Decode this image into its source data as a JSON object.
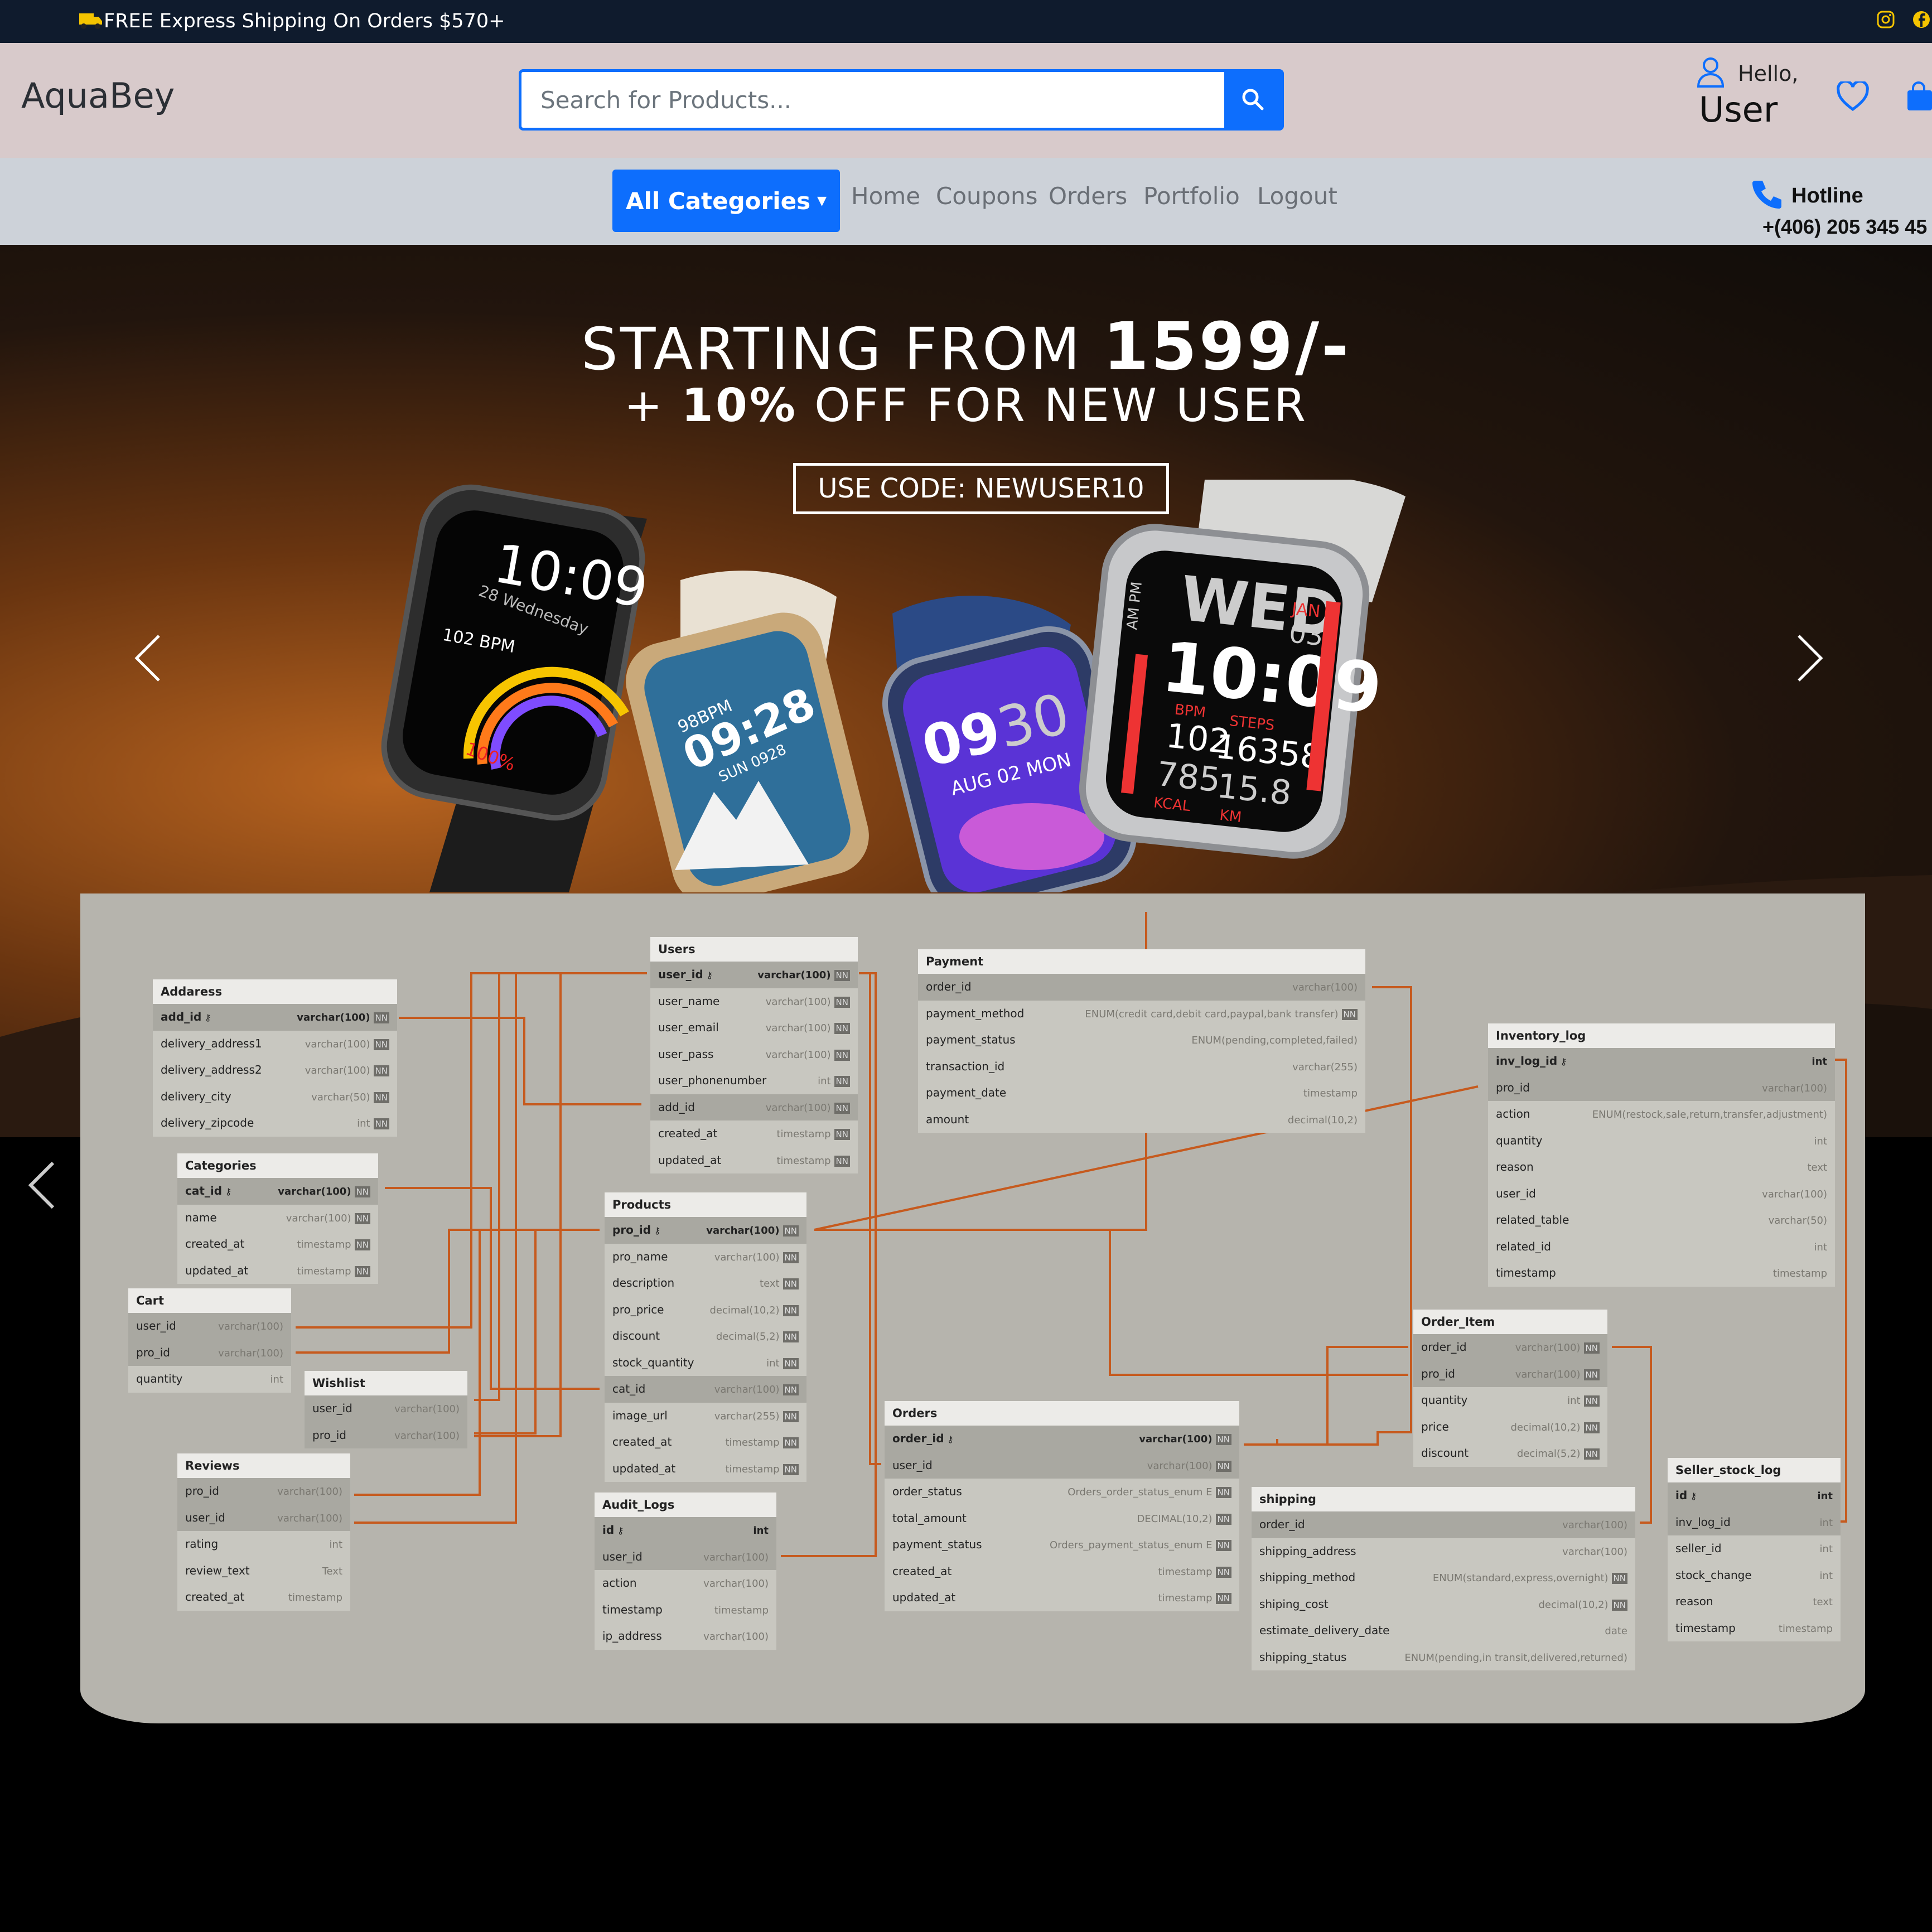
{
  "topbar": {
    "shipping_text": "FREE Express Shipping On Orders $570+",
    "icons": [
      "truck-icon",
      "instagram-icon",
      "facebook-icon"
    ]
  },
  "header": {
    "logo": "AquaBey",
    "search": {
      "placeholder": "Search for Products...",
      "button_icon": "search-icon"
    },
    "greeting": "Hello,",
    "user": "User",
    "icons": [
      "user-icon",
      "heart-icon",
      "cart-icon"
    ]
  },
  "nav": {
    "all_categories": "All Categories",
    "links": [
      "Home",
      "Coupons",
      "Orders",
      "Portfolio",
      "Logout"
    ],
    "hotline_label": "Hotline",
    "hotline_number": "+(406) 205 345 45"
  },
  "hero": {
    "line1_a": "STARTING FROM ",
    "line1_b": "1599/-",
    "line2_a": "+ ",
    "line2_b": "10%",
    "line2_c": " OFF FOR NEW USER",
    "code": "USE CODE: NEWUSER10",
    "watch1": {
      "time": "10:09",
      "date": "28 Wednesday",
      "bpm": "102 BPM",
      "pct": "100%"
    },
    "watch2": {
      "time": "09:28",
      "bpm": "98BPM",
      "date": "SUN 0928"
    },
    "watch3": {
      "time_a": "09",
      "time_b": "30",
      "date": "AUG 02 MON"
    },
    "watch4": {
      "day": "WED",
      "month": "JAN",
      "dnum": "03",
      "time": "10:09",
      "ampm": "AM PM",
      "bpm": "102",
      "bpm_l": "BPM",
      "steps": "16358",
      "steps_l": "STEPS",
      "kcal": "785",
      "kcal_l": "KCAL",
      "km": "15.8",
      "km_l": "KM"
    }
  },
  "erd": {
    "tables": [
      {
        "name": "Addaress",
        "rows": [
          [
            "add_id",
            "varchar(100)",
            "NN",
            1
          ],
          [
            "delivery_address1",
            "varchar(100)",
            "NN",
            0
          ],
          [
            "delivery_address2",
            "varchar(100)",
            "NN",
            0
          ],
          [
            "delivery_city",
            "varchar(50)",
            "NN",
            0
          ],
          [
            "delivery_zipcode",
            "int",
            "NN",
            0
          ]
        ]
      },
      {
        "name": "Categories",
        "rows": [
          [
            "cat_id",
            "varchar(100)",
            "NN",
            1
          ],
          [
            "name",
            "varchar(100)",
            "NN",
            0
          ],
          [
            "created_at",
            "timestamp",
            "NN",
            0
          ],
          [
            "updated_at",
            "timestamp",
            "NN",
            0
          ]
        ]
      },
      {
        "name": "Cart",
        "rows": [
          [
            "user_id",
            "varchar(100)",
            "",
            2
          ],
          [
            "pro_id",
            "varchar(100)",
            "",
            2
          ],
          [
            "quantity",
            "int",
            "",
            0
          ]
        ]
      },
      {
        "name": "Wishlist",
        "rows": [
          [
            "user_id",
            "varchar(100)",
            "",
            2
          ],
          [
            "pro_id",
            "varchar(100)",
            "",
            2
          ]
        ]
      },
      {
        "name": "Reviews",
        "rows": [
          [
            "pro_id",
            "varchar(100)",
            "",
            2
          ],
          [
            "user_id",
            "varchar(100)",
            "",
            2
          ],
          [
            "rating",
            "int",
            "",
            0
          ],
          [
            "review_text",
            "Text",
            "",
            0
          ],
          [
            "created_at",
            "timestamp",
            "",
            0
          ]
        ]
      },
      {
        "name": "Users",
        "rows": [
          [
            "user_id",
            "varchar(100)",
            "NN",
            1
          ],
          [
            "user_name",
            "varchar(100)",
            "NN",
            0
          ],
          [
            "user_email",
            "varchar(100)",
            "NN",
            0
          ],
          [
            "user_pass",
            "varchar(100)",
            "NN",
            0
          ],
          [
            "user_phonenumber",
            "int",
            "NN",
            0
          ],
          [
            "add_id",
            "varchar(100)",
            "NN",
            2
          ],
          [
            "created_at",
            "timestamp",
            "NN",
            0
          ],
          [
            "updated_at",
            "timestamp",
            "NN",
            0
          ]
        ]
      },
      {
        "name": "Products",
        "rows": [
          [
            "pro_id",
            "varchar(100)",
            "NN",
            1
          ],
          [
            "pro_name",
            "varchar(100)",
            "NN",
            0
          ],
          [
            "description",
            "text",
            "NN",
            0
          ],
          [
            "pro_price",
            "decimal(10,2)",
            "NN",
            0
          ],
          [
            "discount",
            "decimal(5,2)",
            "NN",
            0
          ],
          [
            "stock_quantity",
            "int",
            "NN",
            0
          ],
          [
            "cat_id",
            "varchar(100)",
            "NN",
            2
          ],
          [
            "image_url",
            "varchar(255)",
            "NN",
            0
          ],
          [
            "created_at",
            "timestamp",
            "NN",
            0
          ],
          [
            "updated_at",
            "timestamp",
            "NN",
            0
          ]
        ]
      },
      {
        "name": "Audit_Logs",
        "rows": [
          [
            "id",
            "int",
            "",
            1
          ],
          [
            "user_id",
            "varchar(100)",
            "",
            2
          ],
          [
            "action",
            "varchar(100)",
            "",
            0
          ],
          [
            "timestamp",
            "timestamp",
            "",
            0
          ],
          [
            "ip_address",
            "varchar(100)",
            "",
            0
          ]
        ]
      },
      {
        "name": "Payment",
        "rows": [
          [
            "order_id",
            "varchar(100)",
            "",
            2
          ],
          [
            "payment_method",
            "ENUM(credit card,debit card,paypal,bank transfer)",
            "NN",
            0
          ],
          [
            "payment_status",
            "ENUM(pending,completed,failed)",
            "",
            0
          ],
          [
            "transaction_id",
            "varchar(255)",
            "",
            0
          ],
          [
            "payment_date",
            "timestamp",
            "",
            0
          ],
          [
            "amount",
            "decimal(10,2)",
            "",
            0
          ]
        ]
      },
      {
        "name": "Orders",
        "rows": [
          [
            "order_id",
            "varchar(100)",
            "NN",
            1
          ],
          [
            "user_id",
            "varchar(100)",
            "NN",
            2
          ],
          [
            "order_status",
            "Orders_order_status_enum  E",
            "NN",
            0
          ],
          [
            "total_amount",
            "DECIMAL(10,2)",
            "NN",
            0
          ],
          [
            "payment_status",
            "Orders_payment_status_enum  E",
            "NN",
            0
          ],
          [
            "created_at",
            "timestamp",
            "NN",
            0
          ],
          [
            "updated_at",
            "timestamp",
            "NN",
            0
          ]
        ]
      },
      {
        "name": "Inventory_log",
        "rows": [
          [
            "inv_log_id",
            "int",
            "",
            1
          ],
          [
            "pro_id",
            "varchar(100)",
            "",
            2
          ],
          [
            "action",
            "ENUM(restock,sale,return,transfer,adjustment)",
            "",
            0
          ],
          [
            "quantity",
            "int",
            "",
            0
          ],
          [
            "reason",
            "text",
            "",
            0
          ],
          [
            "user_id",
            "varchar(100)",
            "",
            0
          ],
          [
            "related_table",
            "varchar(50)",
            "",
            0
          ],
          [
            "related_id",
            "int",
            "",
            0
          ],
          [
            "timestamp",
            "timestamp",
            "",
            0
          ]
        ]
      },
      {
        "name": "Order_Item",
        "rows": [
          [
            "order_id",
            "varchar(100)",
            "NN",
            2
          ],
          [
            "pro_id",
            "varchar(100)",
            "NN",
            2
          ],
          [
            "quantity",
            "int",
            "NN",
            0
          ],
          [
            "price",
            "decimal(10,2)",
            "NN",
            0
          ],
          [
            "discount",
            "decimal(5,2)",
            "NN",
            0
          ]
        ]
      },
      {
        "name": "shipping",
        "rows": [
          [
            "order_id",
            "varchar(100)",
            "",
            2
          ],
          [
            "shipping_address",
            "varchar(100)",
            "",
            0
          ],
          [
            "shipping_method",
            "ENUM(standard,express,overnight)",
            "NN",
            0
          ],
          [
            "shiping_cost",
            "decimal(10,2)",
            "NN",
            0
          ],
          [
            "estimate_delivery_date",
            "date",
            "",
            0
          ],
          [
            "shipping_status",
            "ENUM(pending,in transit,delivered,returned)",
            "",
            0
          ]
        ]
      },
      {
        "name": "Seller_stock_log",
        "rows": [
          [
            "id",
            "int",
            "",
            1
          ],
          [
            "inv_log_id",
            "int",
            "",
            2
          ],
          [
            "seller_id",
            "int",
            "",
            0
          ],
          [
            "stock_change",
            "int",
            "",
            0
          ],
          [
            "reason",
            "text",
            "",
            0
          ],
          [
            "timestamp",
            "timestamp",
            "",
            0
          ]
        ]
      }
    ]
  }
}
